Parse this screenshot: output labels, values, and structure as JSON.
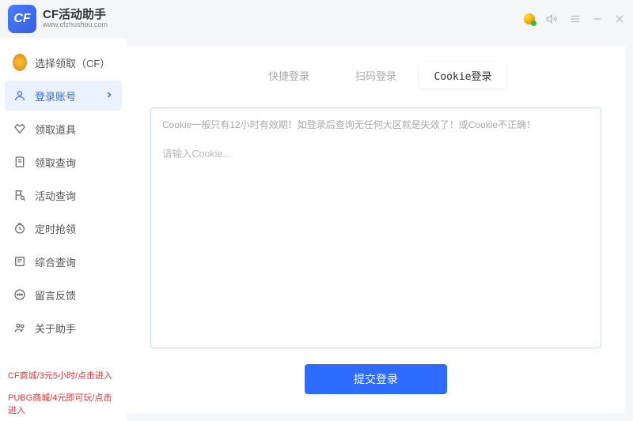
{
  "header": {
    "logo_text": "CF",
    "title": "CF活动助手",
    "url": "www.cfzhushou.com"
  },
  "sidebar": {
    "items": [
      {
        "label": "选择领取（CF）"
      },
      {
        "label": "登录账号"
      },
      {
        "label": "领取道具"
      },
      {
        "label": "领取查询"
      },
      {
        "label": "活动查询"
      },
      {
        "label": "定时抢领"
      },
      {
        "label": "综合查询"
      },
      {
        "label": "留言反馈"
      },
      {
        "label": "关于助手"
      }
    ],
    "promos": [
      "CF商城/3元5小时/点击进入",
      "PUBG商城/4元即可玩/点击进入"
    ]
  },
  "main": {
    "tabs": [
      {
        "label": "快捷登录"
      },
      {
        "label": "扫码登录"
      },
      {
        "label": "Cookie登录"
      }
    ],
    "cookie_hint": "Cookie一般只有12小时有效期！如登录后查询无任何大区就是失效了！或Cookie不正确！",
    "cookie_placeholder": "请输入Cookie...",
    "submit_label": "提交登录"
  }
}
